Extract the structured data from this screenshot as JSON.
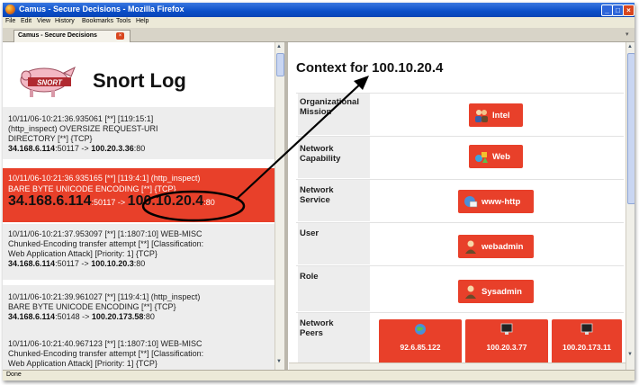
{
  "window": {
    "title": "Camus - Secure Decisions - Mozilla Firefox",
    "buttons": {
      "minimize": "_",
      "maximize": "□",
      "close": "×"
    }
  },
  "menu": [
    "File",
    "Edit",
    "View",
    "History",
    "Bookmarks",
    "Tools",
    "Help"
  ],
  "tab": {
    "label": "Camus - Secure Decisions",
    "close": "×"
  },
  "status": "Done",
  "left_panel": {
    "logo_text": "SNORT",
    "title": "Snort Log",
    "entries": [
      {
        "lines": [
          "10/11/06-10:21:36.935061 [**] [119:15:1]",
          "(http_inspect) OVERSIZE REQUEST-URI",
          "DIRECTORY [**] {TCP}"
        ],
        "src_ip": "34.168.6.114",
        "src_port": ":50117 -> ",
        "dst_ip": "100.20.3.36",
        "dst_port": ":80",
        "highlighted": false
      },
      {
        "lines": [
          "10/11/06-10:21:36.935165 [**] [119:4:1] (http_inspect)",
          "BARE BYTE UNICODE ENCODING [**] {TCP}"
        ],
        "src_ip": "34.168.6.114",
        "src_port": ":50117 -> ",
        "dst_ip": "100.10.20.4",
        "dst_port": ":80",
        "highlighted": true
      },
      {
        "lines": [
          "10/11/06-10:21:37.953097 [**] [1:1807:10] WEB-MISC",
          "Chunked-Encoding transfer attempt [**] [Classification:",
          "Web Application Attack] [Priority: 1] {TCP}"
        ],
        "src_ip": "34.168.6.114",
        "src_port": ":50117 -> ",
        "dst_ip": "100.10.20.3",
        "dst_port": ":80",
        "highlighted": false
      },
      {
        "lines": [
          "10/11/06-10:21:39.961027 [**] [119:4:1] (http_inspect)",
          "BARE BYTE UNICODE ENCODING [**] {TCP}"
        ],
        "src_ip": "34.168.6.114",
        "src_port": ":50148 -> ",
        "dst_ip": "100.20.173.58",
        "dst_port": ":80",
        "highlighted": false
      },
      {
        "lines": [
          "10/11/06-10:21:40.967123 [**] [1:1807:10] WEB-MISC",
          "Chunked-Encoding transfer attempt [**] [Classification:",
          "Web Application Attack] [Priority: 1] {TCP}"
        ],
        "highlighted": false
      }
    ]
  },
  "right_panel": {
    "title": "Context for 100.10.20.4",
    "rows": [
      {
        "label": [
          "Organizational",
          "Mission"
        ],
        "value": "Intel",
        "icon": "people-icon"
      },
      {
        "label": [
          "Network",
          "Capability"
        ],
        "value": "Web",
        "icon": "shapes-icon"
      },
      {
        "label": [
          "Network",
          "Service"
        ],
        "value": "www-http",
        "icon": "globe-envelope-icon"
      },
      {
        "label": [
          "User"
        ],
        "value": "webadmin",
        "icon": "user-icon"
      },
      {
        "label": [
          "Role"
        ],
        "value": "Sysadmin",
        "icon": "user-icon"
      },
      {
        "label": [
          "Network",
          "Peers"
        ],
        "peers": [
          "92.6.85.122",
          "100.20.3.77",
          "100.20.173.11"
        ]
      }
    ]
  },
  "colors": {
    "accent": "#e8402a",
    "row_bg": "#ededed",
    "titlebar": "#0a4ec8"
  }
}
